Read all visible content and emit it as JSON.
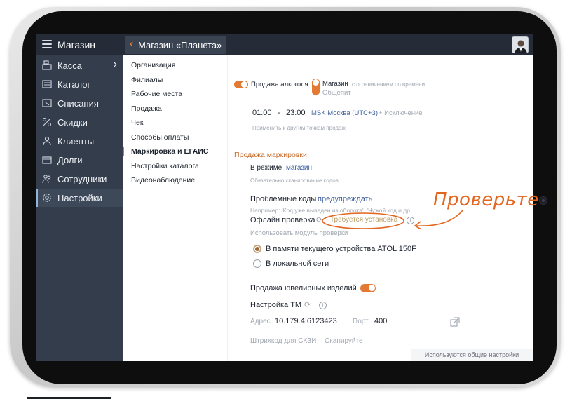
{
  "app": {
    "title": "Магазин"
  },
  "store_tab": {
    "name": "Магазин «Планета»"
  },
  "sidebar": {
    "items": [
      {
        "label": "Касса",
        "icon": "cash-register-icon"
      },
      {
        "label": "Каталог",
        "icon": "catalog-icon"
      },
      {
        "label": "Списания",
        "icon": "write-off-icon"
      },
      {
        "label": "Скидки",
        "icon": "percent-icon"
      },
      {
        "label": "Клиенты",
        "icon": "clients-icon"
      },
      {
        "label": "Долги",
        "icon": "debts-icon"
      },
      {
        "label": "Сотрудники",
        "icon": "staff-icon"
      },
      {
        "label": "Настройки",
        "icon": "gear-icon"
      }
    ]
  },
  "subnav": {
    "items": [
      "Организация",
      "Филиалы",
      "Рабочие места",
      "Продажа",
      "Чек",
      "Способы оплаты",
      "Маркировка и ЕГАИС",
      "Настройки каталога",
      "Видеонаблюдение"
    ],
    "active": "Маркировка и ЕГАИС"
  },
  "alcohol": {
    "label": "Продажа алкоголя",
    "option_store": "Магазин",
    "option_note": "с ограничением по времени",
    "option_cafe": "Общепит",
    "time_from": "01:00",
    "dash": "-",
    "time_to": "23:00",
    "timezone": "MSK Москва (UTC+3)",
    "exception": "+ Исключение",
    "apply_hint": "Применить к другим точкам продаж"
  },
  "marking": {
    "section_title": "Продажа маркировки",
    "mode_label": "В режиме",
    "mode_value": "магазин",
    "mode_hint": "Обязательно сканирование кодов",
    "problem_label": "Проблемные коды",
    "problem_value": "предупреждать",
    "problem_hint": "Например: 'Код уже выведен из оборота', 'Чужой код и др.",
    "offline_label": "Офлайн проверка",
    "offline_status": "Требуется установка",
    "offline_hint": "Использовать модуль проверки",
    "radio_1": "В памяти текущего устройства ATOL 150F",
    "radio_2": "В локальной сети",
    "jewelry_label": "Продажа ювелирных изделий",
    "tm_label": "Настройка ТМ",
    "address_label": "Адрес",
    "address_value": "10.179.4.6123423",
    "port_label": "Порт",
    "port_value": "400",
    "barcode_label": "Штрихкод для СКЗИ",
    "scan_label": "Сканируйте",
    "footer_note": "Используются общие настройки"
  },
  "annotation": {
    "text": "Проверьте"
  },
  "colors": {
    "accent": "#e37a34",
    "sidebar": "#333d4c",
    "topbar": "#252c38",
    "link": "#3f62a0"
  }
}
